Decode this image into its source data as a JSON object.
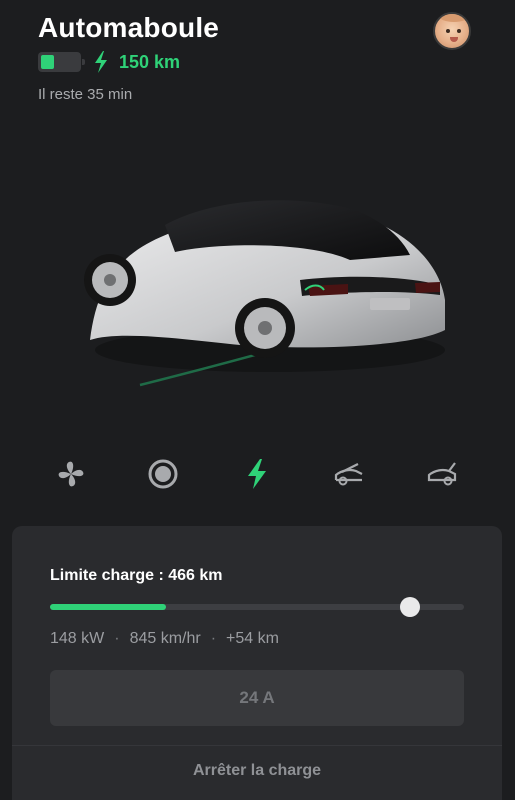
{
  "header": {
    "car_name": "Automaboule",
    "range": "150 km",
    "time_left": "Il reste 35 min",
    "battery_level": 0.35
  },
  "controls": [
    {
      "icon": "fan-icon"
    },
    {
      "icon": "defrost-circle-icon"
    },
    {
      "icon": "charging-bolt-icon",
      "active": true
    },
    {
      "icon": "frunk-open-icon"
    },
    {
      "icon": "trunk-open-icon"
    }
  ],
  "charging": {
    "limit_label": "Limite charge : 466 km",
    "current_progress": 0.28,
    "limit_progress": 0.87,
    "power": "148 kW",
    "rate": "845 km/hr",
    "added": "+54 km",
    "separator": "·",
    "amperage": "24 A",
    "stop_label": "Arrêter la charge"
  },
  "colors": {
    "accent": "#2fd278",
    "background": "#1c1d1f",
    "panel": "#2a2b2e"
  }
}
